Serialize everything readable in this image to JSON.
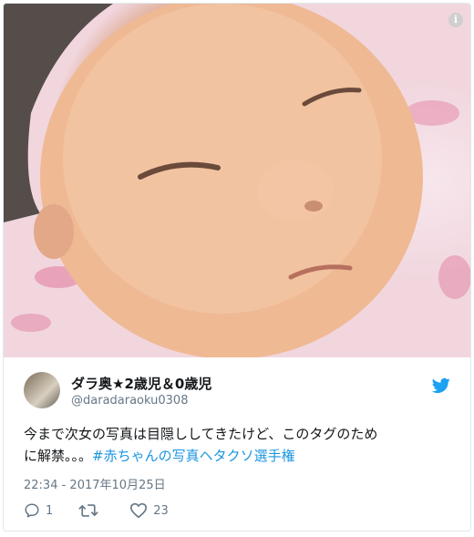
{
  "photo": {
    "alt": "sleeping baby close-up photo",
    "info_icon": "i"
  },
  "user": {
    "display_name": "ダラ奥★2歳児＆0歳児",
    "handle": "@daradaraoku0308"
  },
  "tweet": {
    "text_line1": "今まで次女の写真は目隠ししてきたけど、このタグのため",
    "text_line2_prefix": "に解禁。。。",
    "hashtag": "#赤ちゃんの写真ヘタクソ選手権"
  },
  "timestamp": "22:34 - 2017年10月25日",
  "actions": {
    "reply_count": "1",
    "retweet_count": "",
    "like_count": "23"
  },
  "colors": {
    "accent": "#1da1f2",
    "link": "#1b95e0",
    "muted": "#657786",
    "text": "#14171a"
  },
  "icons": [
    "info-icon",
    "twitter-bird-icon",
    "reply-icon",
    "retweet-icon",
    "heart-icon"
  ]
}
